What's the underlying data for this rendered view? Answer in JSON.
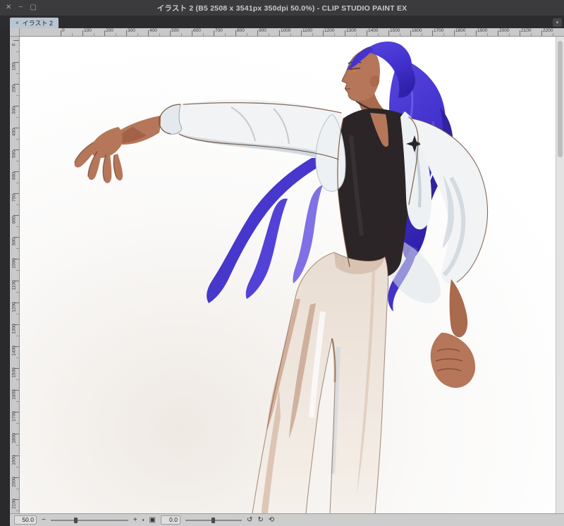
{
  "window": {
    "title": "イラスト 2 (B5 2508 x 3541px 350dpi 50.0%) - CLIP STUDIO PAINT EX",
    "controls": {
      "close": "✕",
      "minimize": "−",
      "maximize": "▢"
    }
  },
  "tab_bar": {
    "tabs": [
      {
        "label": "イラスト 2",
        "close_glyph": "×"
      }
    ],
    "list_glyph": "▾"
  },
  "rulers": {
    "horizontal": {
      "labels": [
        "0",
        "100",
        "200",
        "300",
        "400",
        "500",
        "600",
        "700",
        "800",
        "900",
        "1000",
        "1100",
        "1200",
        "1300",
        "1400",
        "1500",
        "1600",
        "1700",
        "1800",
        "1900",
        "2000",
        "2100",
        "2200"
      ]
    },
    "vertical": {
      "labels": [
        "0",
        "100",
        "200",
        "300",
        "400",
        "500",
        "600",
        "700",
        "800",
        "900",
        "1000",
        "1100",
        "1200",
        "1300",
        "1400",
        "1500",
        "1600",
        "1700",
        "1800",
        "1900",
        "2000",
        "2100"
      ]
    }
  },
  "status_bar": {
    "zoom": {
      "value": "50.0",
      "out_glyph": "−",
      "in_glyph": "+"
    },
    "rotation": {
      "value": "0.0",
      "left_glyph": "↺",
      "right_glyph": "↻",
      "reset_glyph": "⟲"
    },
    "actual_size_glyph": "▪",
    "fit_glyph": "▣"
  },
  "canvas": {
    "artwork": {
      "description": "rough digital painting sketch of a tall man with long purple hair in a ponytail, dark skin, black vest over white rolled-sleeve shirt, white towel on shoulders, right arm extended to the left",
      "palette": {
        "hair": "#4231cd",
        "hair_dark": "#2f21ab",
        "skin": "#b5765a",
        "vest": "#2b2527",
        "cloth": "#f1f3f5",
        "cloth_shade": "#c6d0d8",
        "pants": "#eadfd5",
        "pants_shade": "#c79e86",
        "outline": "#6b4632"
      }
    }
  }
}
